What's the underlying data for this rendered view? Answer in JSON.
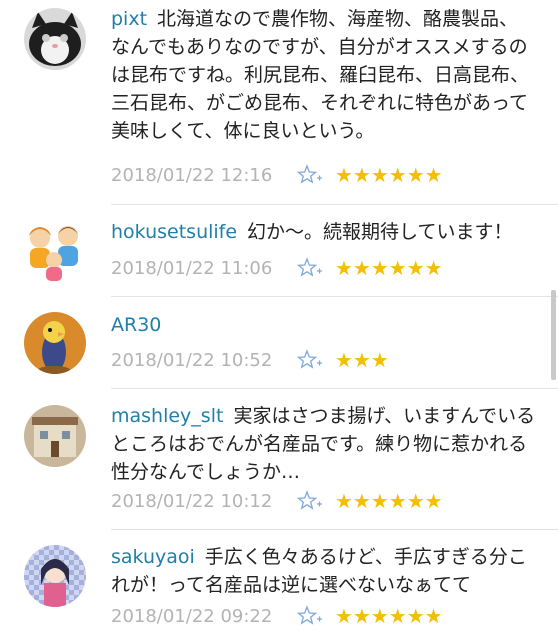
{
  "comments": [
    {
      "user": "pixt",
      "text": "北海道なので農作物、海産物、酪農製品、なんでもありなのですが、自分がオススメするのは昆布ですね。利尻昆布、羅臼昆布、日高昆布、三石昆布、がごめ昆布、それぞれに特色があって美味しくて、体に良いという。",
      "date": "2018/01/22 12:16",
      "stars": "★★★★★★",
      "star_count": 6
    },
    {
      "user": "hokusetsulife",
      "text": "幻か〜。続報期待しています！",
      "date": "2018/01/22 11:06",
      "stars": "★★★★★★",
      "star_count": 6
    },
    {
      "user": "AR30",
      "text": "",
      "date": "2018/01/22 10:52",
      "stars": "★★★",
      "star_count": 3
    },
    {
      "user": "mashley_slt",
      "text": "実家はさつま揚げ、いますんでいるところはおでんが名産品です。練り物に惹かれる性分なんでしょうか…",
      "date": "2018/01/22 10:12",
      "stars": "★★★★★★",
      "star_count": 6
    },
    {
      "user": "sakuyaoi",
      "text": "手広く色々あるけど、手広すぎる分これが！って名産品は逆に選べないなぁてて",
      "date": "2018/01/22 09:22",
      "stars": "★★★★★★",
      "star_count": 6
    }
  ],
  "colors": {
    "username": "#1f7fa8",
    "date": "#b3b3b3",
    "star": "#f3bf06",
    "add_star_icon": "#7fa9d9",
    "divider": "#e3e3e3"
  }
}
